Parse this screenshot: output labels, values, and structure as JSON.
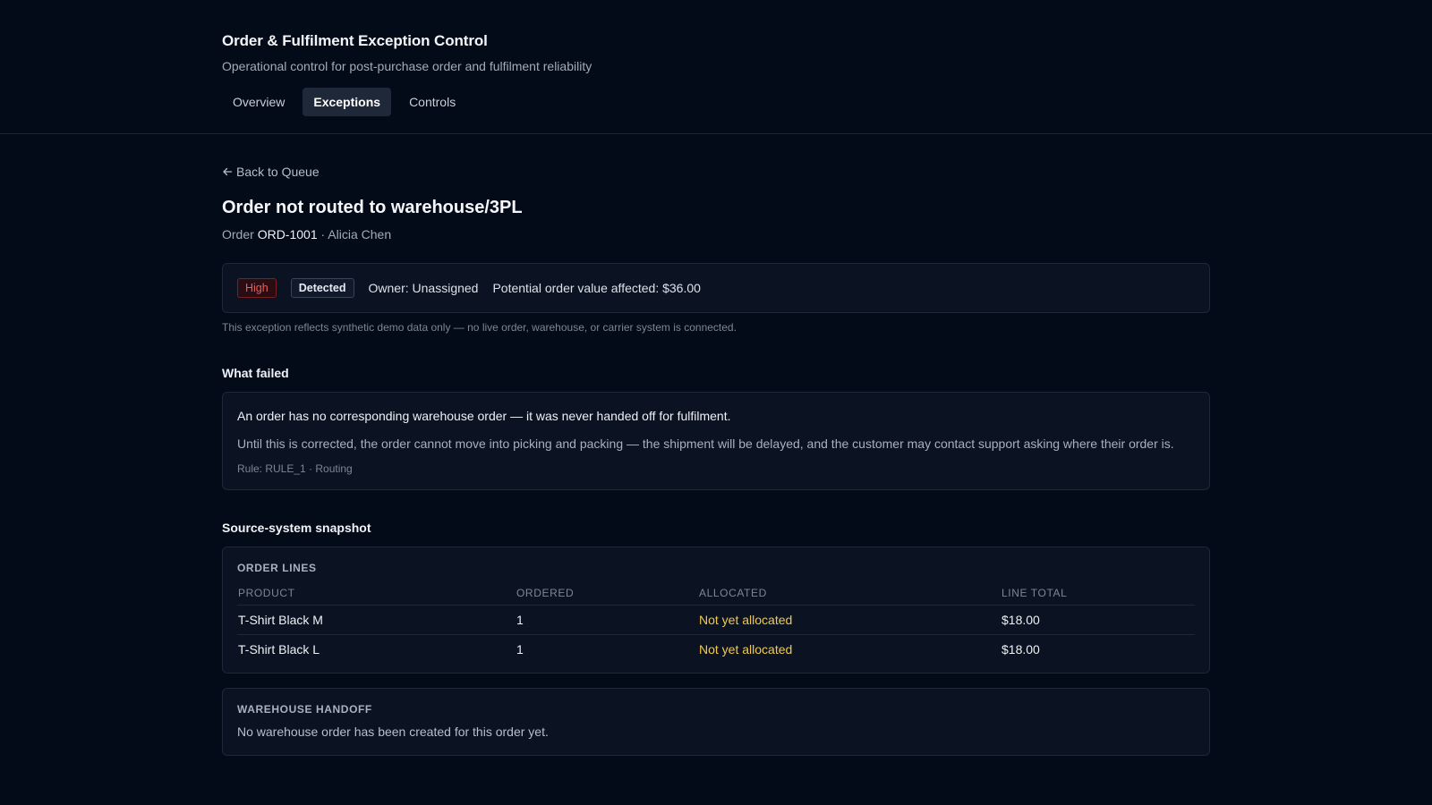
{
  "app": {
    "title": "Order & Fulfilment Exception Control",
    "subtitle": "Operational control for post-purchase order and fulfilment reliability"
  },
  "tabs": [
    {
      "label": "Overview",
      "active": false
    },
    {
      "label": "Exceptions",
      "active": true
    },
    {
      "label": "Controls",
      "active": false
    }
  ],
  "back_link": {
    "icon": "arrow-left-icon",
    "label": "Back to Queue"
  },
  "exception": {
    "title": "Order not routed to warehouse/3PL",
    "order_prefix": "Order",
    "order_id": "ORD-1001",
    "separator": "·",
    "customer": "Alicia Chen",
    "severity": "High",
    "status": "Detected",
    "owner": "Owner: Unassigned",
    "value_affected": "Potential order value affected: $36.00",
    "disclaimer": "This exception reflects synthetic demo data only — no live order, warehouse, or carrier system is connected."
  },
  "what_failed": {
    "heading": "What failed",
    "headline": "An order has no corresponding warehouse order — it was never handed off for fulfilment.",
    "body": "Until this is corrected, the order cannot move into picking and packing — the shipment will be delayed, and the customer may contact support asking where their order is.",
    "rule": "Rule: RULE_1 · Routing"
  },
  "snapshot": {
    "heading": "Source-system snapshot",
    "order_lines": {
      "label": "ORDER LINES",
      "columns": [
        "PRODUCT",
        "ORDERED",
        "ALLOCATED",
        "LINE TOTAL"
      ],
      "rows": [
        {
          "product": "T-Shirt Black M",
          "ordered": "1",
          "allocated": "Not yet allocated",
          "line_total": "$18.00"
        },
        {
          "product": "T-Shirt Black L",
          "ordered": "1",
          "allocated": "Not yet allocated",
          "line_total": "$18.00"
        }
      ]
    },
    "warehouse_handoff": {
      "label": "WAREHOUSE HANDOFF",
      "text": "No warehouse order has been created for this order yet."
    }
  },
  "colors": {
    "background": "#030a18",
    "card": "#0b1322",
    "severity_high": "#f05a5a",
    "allocation_warning": "#f2c94c"
  }
}
